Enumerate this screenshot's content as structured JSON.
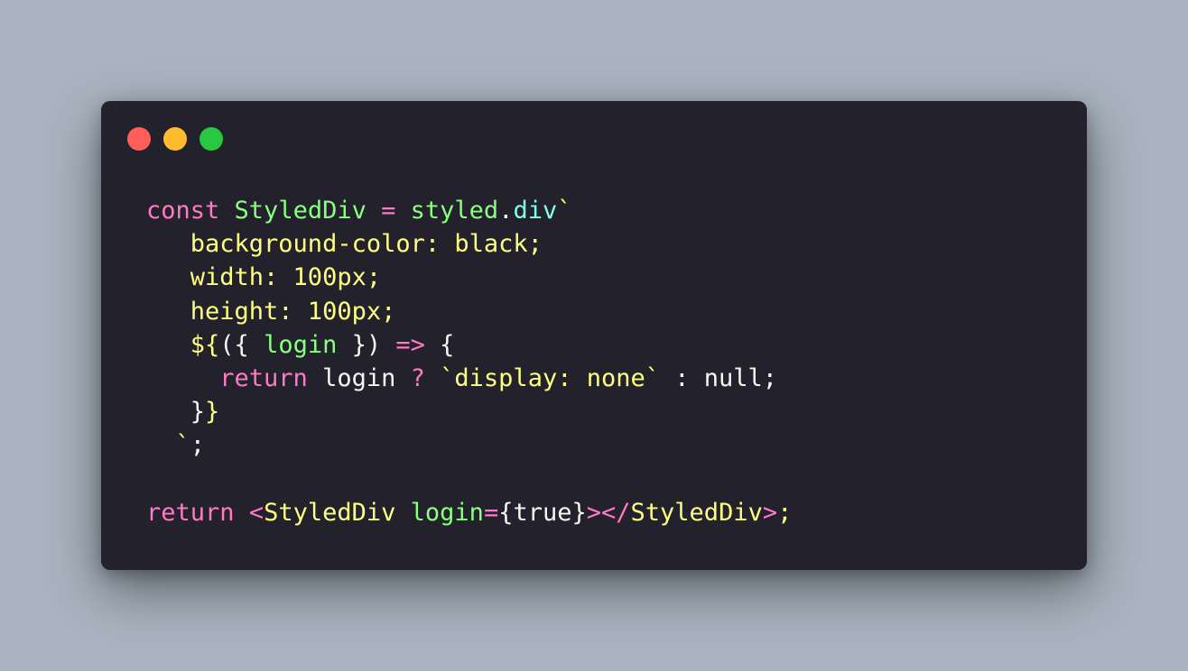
{
  "window": {
    "controls": [
      "close",
      "minimize",
      "maximize"
    ],
    "colors": {
      "background": "#22212c",
      "close": "#ff5f57",
      "minimize": "#febc2e",
      "maximize": "#28c840",
      "keyword": "#ff79c6",
      "identifier": "#8aff80",
      "string": "#ffff80",
      "property": "#80ffea",
      "text": "#f8f8f2"
    }
  },
  "code": {
    "lines": [
      [
        {
          "t": "const",
          "c": "k"
        },
        {
          "t": " ",
          "c": "w"
        },
        {
          "t": "StyledDiv",
          "c": "g"
        },
        {
          "t": " ",
          "c": "w"
        },
        {
          "t": "=",
          "c": "k"
        },
        {
          "t": " ",
          "c": "w"
        },
        {
          "t": "styled",
          "c": "g"
        },
        {
          "t": ".",
          "c": "w"
        },
        {
          "t": "div",
          "c": "c"
        },
        {
          "t": "`",
          "c": "y"
        }
      ],
      [
        {
          "t": "   background-color: black;",
          "c": "y"
        }
      ],
      [
        {
          "t": "   width: 100px;",
          "c": "y"
        }
      ],
      [
        {
          "t": "   height: 100px;",
          "c": "y"
        }
      ],
      [
        {
          "t": "   ${",
          "c": "y"
        },
        {
          "t": "({ ",
          "c": "w"
        },
        {
          "t": "login",
          "c": "g"
        },
        {
          "t": " }) ",
          "c": "w"
        },
        {
          "t": "=>",
          "c": "k"
        },
        {
          "t": " {",
          "c": "w"
        }
      ],
      [
        {
          "t": "     ",
          "c": "w"
        },
        {
          "t": "return",
          "c": "k"
        },
        {
          "t": " login ",
          "c": "w"
        },
        {
          "t": "?",
          "c": "k"
        },
        {
          "t": " ",
          "c": "w"
        },
        {
          "t": "`display: none`",
          "c": "y"
        },
        {
          "t": " : null;",
          "c": "w"
        }
      ],
      [
        {
          "t": "   }",
          "c": "w"
        },
        {
          "t": "}",
          "c": "y"
        }
      ],
      [
        {
          "t": "  `",
          "c": "y"
        },
        {
          "t": ";",
          "c": "w"
        }
      ],
      [
        {
          "t": "",
          "c": "w"
        }
      ],
      [
        {
          "t": "return",
          "c": "k"
        },
        {
          "t": " ",
          "c": "w"
        },
        {
          "t": "<",
          "c": "k"
        },
        {
          "t": "StyledDiv",
          "c": "y"
        },
        {
          "t": " ",
          "c": "w"
        },
        {
          "t": "login",
          "c": "g"
        },
        {
          "t": "=",
          "c": "k"
        },
        {
          "t": "{true}",
          "c": "w"
        },
        {
          "t": "></",
          "c": "k"
        },
        {
          "t": "StyledDiv",
          "c": "y"
        },
        {
          "t": ">",
          "c": "k"
        },
        {
          "t": ";",
          "c": "y"
        }
      ]
    ]
  }
}
